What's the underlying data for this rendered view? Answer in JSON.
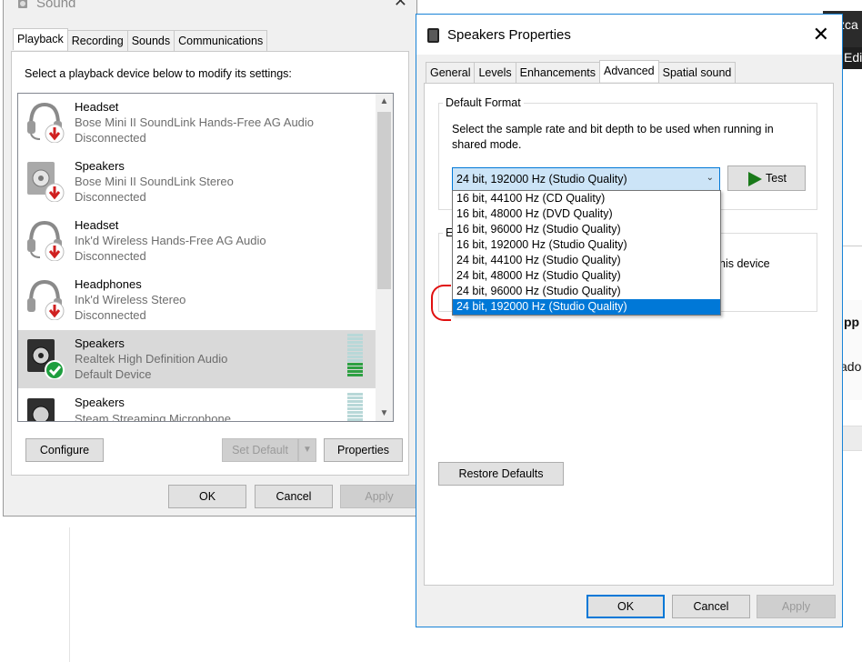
{
  "background": {
    "frag_top": "zca",
    "frag_edi": "Edi",
    "frag_app": "pp",
    "frag_ado": "ado"
  },
  "sound_dialog": {
    "title": "Sound",
    "close": "✕",
    "tabs": [
      "Playback",
      "Recording",
      "Sounds",
      "Communications"
    ],
    "active_tab": 0,
    "instruction": "Select a playback device below to modify its settings:",
    "devices": [
      {
        "name": "Headset",
        "desc": "Bose Mini II SoundLink Hands-Free AG Audio",
        "status": "Disconnected",
        "icon": "headset-disconnected-icon",
        "selected": false,
        "level": 0
      },
      {
        "name": "Speakers",
        "desc": "Bose Mini II SoundLink Stereo",
        "status": "Disconnected",
        "icon": "speaker-disconnected-icon",
        "selected": false,
        "level": 0
      },
      {
        "name": "Headset",
        "desc": "Ink'd Wireless Hands-Free AG Audio",
        "status": "Disconnected",
        "icon": "headset-disconnected-icon",
        "selected": false,
        "level": 0
      },
      {
        "name": "Headphones",
        "desc": "Ink'd Wireless Stereo",
        "status": "Disconnected",
        "icon": "headphones-disconnected-icon",
        "selected": false,
        "level": 0
      },
      {
        "name": "Speakers",
        "desc": "Realtek High Definition Audio",
        "status": "Default Device",
        "icon": "speaker-default-icon",
        "selected": true,
        "level": 4
      },
      {
        "name": "Speakers",
        "desc": "Steam Streaming Microphone",
        "status": "",
        "icon": "speaker-icon",
        "selected": false,
        "level": 0
      }
    ],
    "buttons": {
      "configure": "Configure",
      "set_default": "Set Default",
      "properties": "Properties",
      "ok": "OK",
      "cancel": "Cancel",
      "apply": "Apply"
    }
  },
  "properties_dialog": {
    "title": "Speakers Properties",
    "close": "✕",
    "tabs": [
      "General",
      "Levels",
      "Enhancements",
      "Advanced",
      "Spatial sound"
    ],
    "active_tab": 3,
    "default_format": {
      "label": "Default Format",
      "description": "Select the sample rate and bit depth to be used when running in shared mode.",
      "selected_value": "24 bit, 192000 Hz (Studio Quality)",
      "options": [
        "16 bit, 44100 Hz (CD Quality)",
        "16 bit, 48000 Hz (DVD Quality)",
        "16 bit, 96000 Hz (Studio Quality)",
        "16 bit, 192000 Hz (Studio Quality)",
        "24 bit, 44100 Hz (Studio Quality)",
        "24 bit, 48000 Hz (Studio Quality)",
        "24 bit, 96000 Hz (Studio Quality)",
        "24 bit, 192000 Hz (Studio Quality)"
      ],
      "selected_index": 7,
      "test_label": "Test"
    },
    "exclusive_partial": {
      "label_fragment": "E",
      "text_fragment": "his device"
    },
    "buttons": {
      "restore_defaults": "Restore Defaults",
      "ok": "OK",
      "cancel": "Cancel",
      "apply": "Apply"
    }
  },
  "colors": {
    "accent": "#0078d7",
    "dialog_bg": "#f0f0f0",
    "selected_row": "#d9d9d9",
    "default_check": "#2ea043",
    "disconnected_arrow": "#d02020",
    "annotation_red": "#e01010"
  }
}
